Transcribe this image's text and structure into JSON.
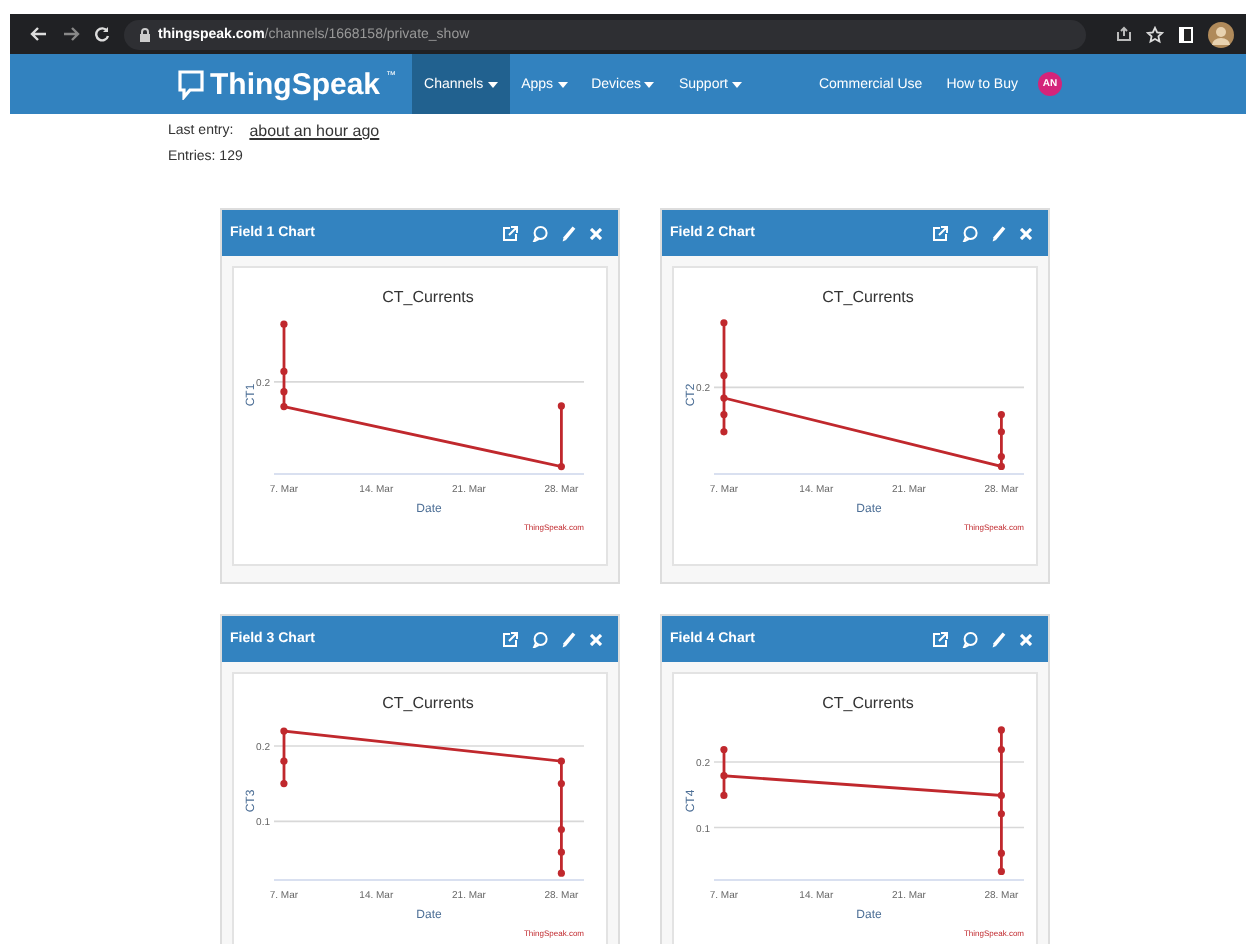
{
  "browser": {
    "url_domain": "thingspeak.com",
    "url_path": "/channels/1668158/private_show"
  },
  "nav": {
    "brand": "ThingSpeak",
    "trademark": "™",
    "items": [
      {
        "label": "Channels",
        "selected": true
      },
      {
        "label": "Apps",
        "selected": false
      },
      {
        "label": "Devices",
        "selected": false
      },
      {
        "label": "Support",
        "selected": false
      }
    ],
    "right_links": [
      "Commercial Use",
      "How to Buy"
    ],
    "avatar": "AN"
  },
  "channel_info": {
    "last_entry_label": "Last entry:",
    "last_entry_value": "about an hour ago",
    "entries": "Entries: 129"
  },
  "charts": [
    {
      "title": "Field 1 Chart",
      "chart_title": "CT_Currents",
      "ylabel": "CT1",
      "yticks": [
        "0.2"
      ],
      "xticks": [
        "7. Mar",
        "14. Mar",
        "21. Mar",
        "28. Mar"
      ],
      "xlabel": "Date",
      "credit": "ThingSpeak.com"
    },
    {
      "title": "Field 2 Chart",
      "chart_title": "CT_Currents",
      "ylabel": "CT2",
      "yticks": [
        "0.2"
      ],
      "xticks": [
        "7. Mar",
        "14. Mar",
        "21. Mar",
        "28. Mar"
      ],
      "xlabel": "Date",
      "credit": "ThingSpeak.com"
    },
    {
      "title": "Field 3 Chart",
      "chart_title": "CT_Currents",
      "ylabel": "CT3",
      "yticks": [
        "0.2",
        "0.1"
      ],
      "xticks": [
        "7. Mar",
        "14. Mar",
        "21. Mar",
        "28. Mar"
      ],
      "xlabel": "Date",
      "credit": "ThingSpeak.com"
    },
    {
      "title": "Field 4 Chart",
      "chart_title": "CT_Currents",
      "ylabel": "CT4",
      "yticks": [
        "0.2",
        "0.1"
      ],
      "xticks": [
        "7. Mar",
        "14. Mar",
        "21. Mar",
        "28. Mar"
      ],
      "xlabel": "Date",
      "credit": "ThingSpeak.com"
    }
  ]
}
